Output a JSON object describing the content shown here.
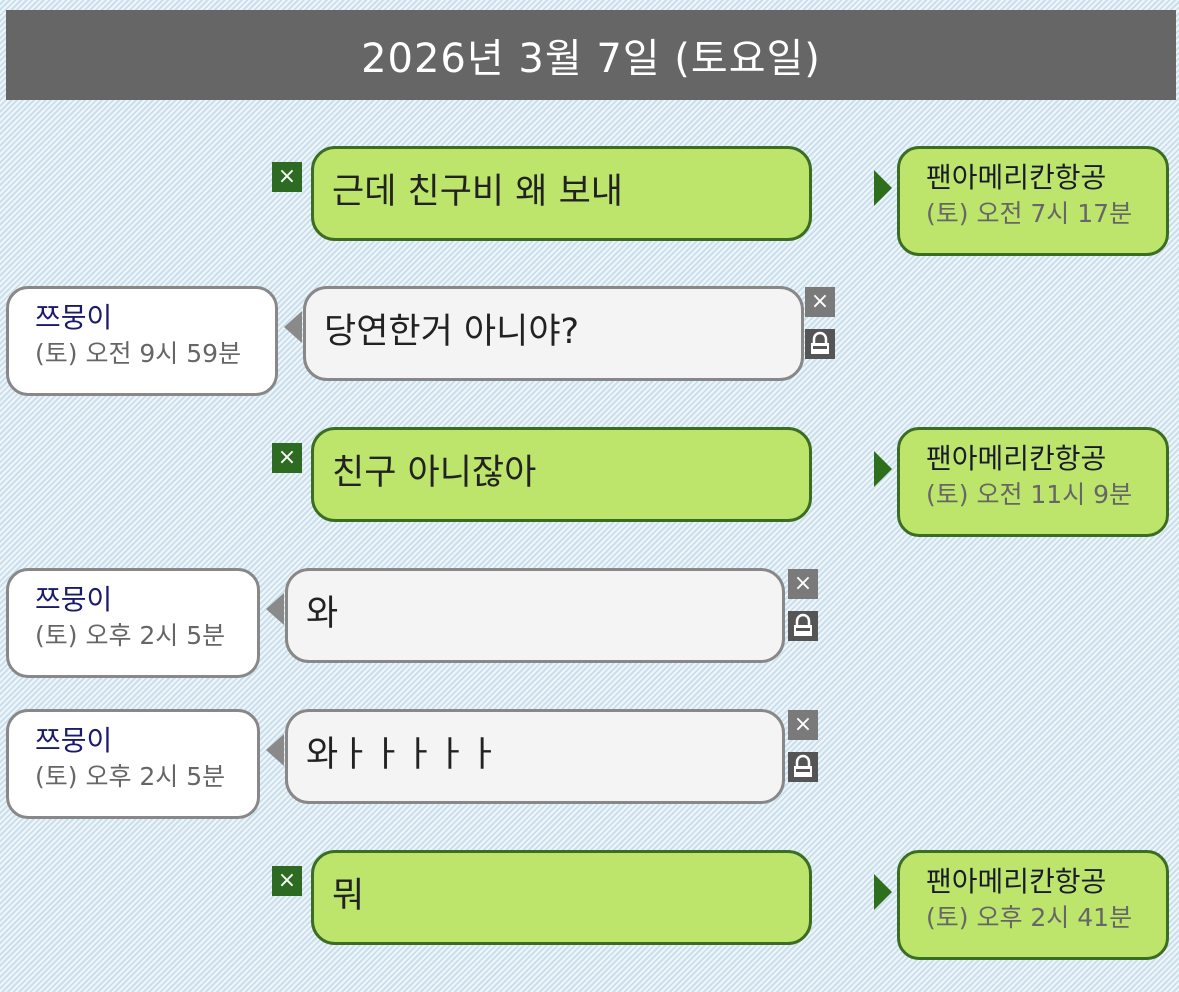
{
  "header": {
    "date": "2026년 3월 7일 (토요일)"
  },
  "messages": [
    {
      "dir": "out",
      "text": "근데 친구비 왜 보내",
      "sender": "팬아메리칸항공",
      "time": "(토) 오전 7시 17분"
    },
    {
      "dir": "in",
      "text": "당연한거 아니야?",
      "sender": "쯔뭉이",
      "time": "(토) 오전 9시 59분"
    },
    {
      "dir": "out",
      "text": "친구 아니잖아",
      "sender": "팬아메리칸항공",
      "time": "(토) 오전 11시 9분"
    },
    {
      "dir": "in",
      "text": "와",
      "sender": "쯔뭉이",
      "time": "(토) 오후 2시 5분"
    },
    {
      "dir": "in",
      "text": "와ㅏㅏㅏㅏㅏ",
      "sender": "쯔뭉이",
      "time": "(토) 오후 2시 5분"
    },
    {
      "dir": "out",
      "text": "뭐",
      "sender": "팬아메리칸항공",
      "time": "(토) 오후 2시 41분"
    }
  ],
  "icons": {
    "delete": "close-icon",
    "lock": "lock-icon"
  },
  "colors": {
    "outgoing_bubble": "#bde56c",
    "incoming_bubble": "#f4f4f4",
    "header_bg": "#666666"
  }
}
